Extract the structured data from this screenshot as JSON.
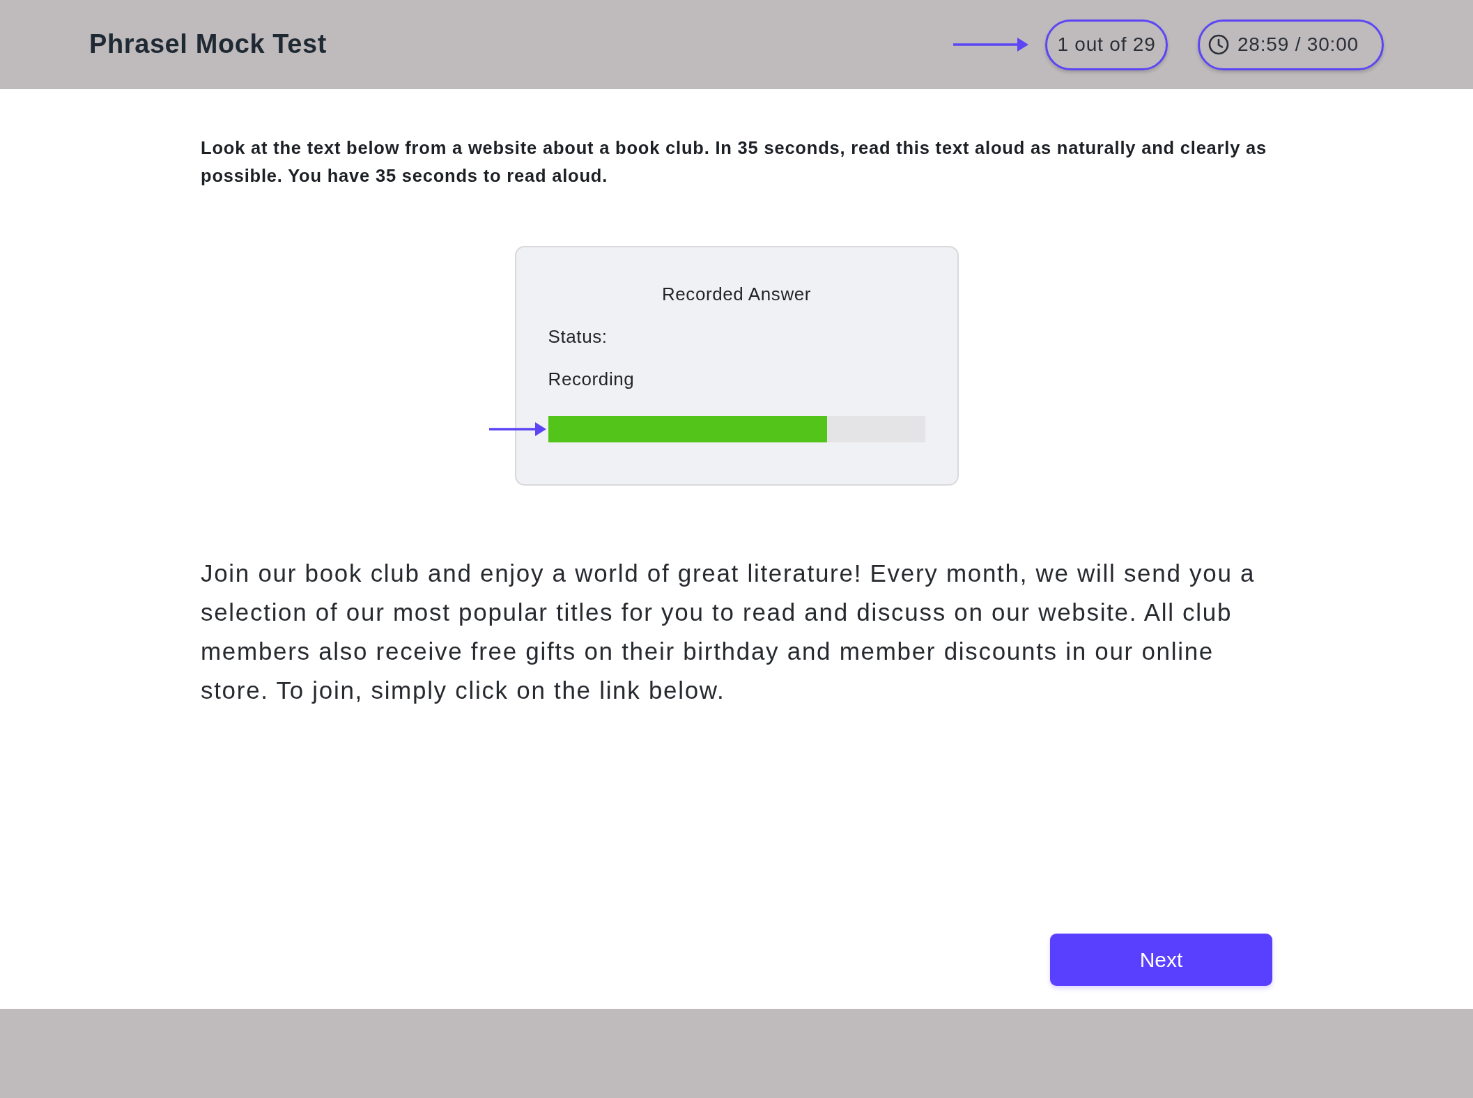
{
  "header": {
    "title": "Phrasel Mock Test",
    "question_counter": {
      "text": "1 out of 29",
      "circled": true,
      "arrow": true
    },
    "timer": {
      "text": "28:59 / 30:00",
      "circled": true
    }
  },
  "instructions": "Look at the text below from a website about a book club. In 35 seconds, read this text aloud as naturally and clearly as possible. You have 35 seconds to read aloud.",
  "recorder": {
    "title": "Recorded Answer",
    "status_label": "Status:",
    "status": "Recording",
    "level": 0.74,
    "arrow": true
  },
  "passage": "Join our book club and enjoy a world of great literature! Every month, we will send you a selection of our most popular titles for you to read and discuss on our website. All club members also receive free gifts on their birthday and member discounts in our online store. To join, simply click on the link below.",
  "buttons": [
    {
      "label": "Next"
    }
  ]
}
